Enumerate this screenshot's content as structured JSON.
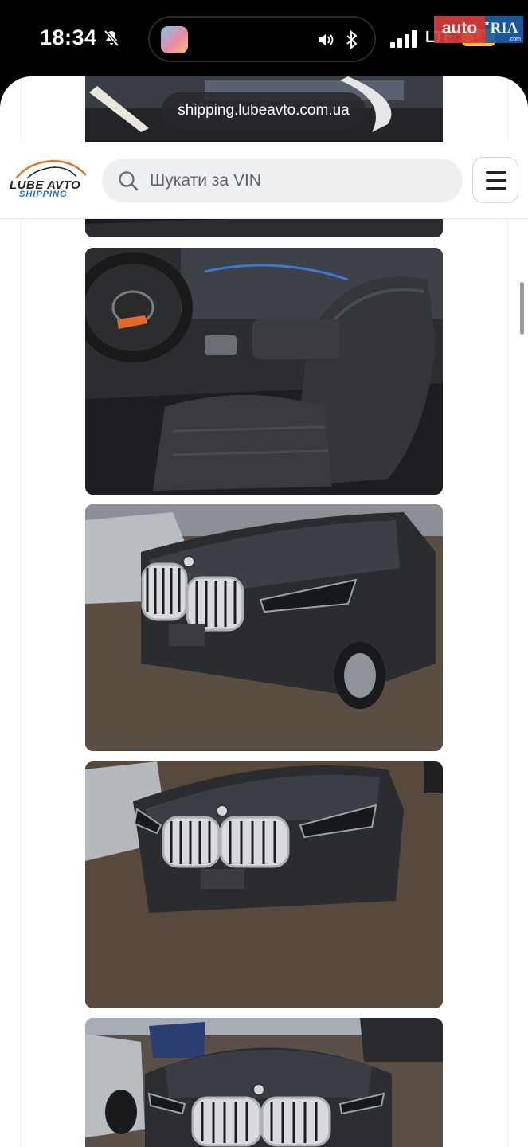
{
  "status_bar": {
    "time": "18:34",
    "network": "LTE",
    "battery": "14",
    "colors": {
      "battery": "#f2c531"
    },
    "icons": [
      "bell-slash-icon",
      "speaker-icon",
      "bluetooth-icon",
      "signal-icon",
      "battery-icon"
    ]
  },
  "watermark": {
    "auto": "auto",
    "ria": "RIA",
    "domain": ".com"
  },
  "browser": {
    "url": "shipping.lubeavto.com.ua"
  },
  "site": {
    "logo_top": "LUBE AVTO",
    "logo_bottom": "SHIPPING",
    "search_placeholder": "Шукати за VIN",
    "colors": {
      "logo_blue": "#1f6fd1",
      "search_bg": "#eeeff1"
    },
    "icons": [
      "search-icon",
      "hamburger-menu-icon"
    ]
  },
  "gallery": {
    "photos": [
      {
        "subject": "car interior dashboard"
      },
      {
        "subject": "car interior front seats"
      },
      {
        "subject": "black BMW X5 front three-quarter view"
      },
      {
        "subject": "black BMW X5 front view"
      },
      {
        "subject": "black BMW X5 front view in lot"
      }
    ]
  }
}
